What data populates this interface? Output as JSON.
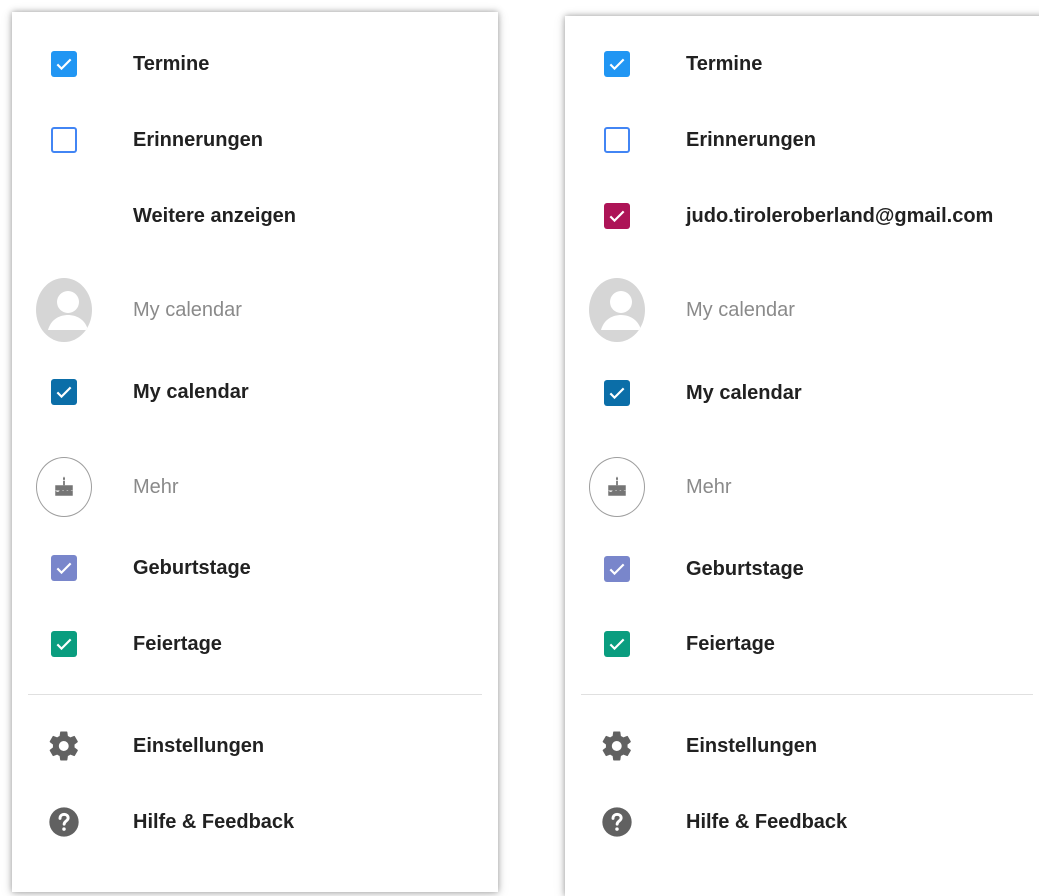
{
  "left": {
    "items": [
      {
        "label": "Termine"
      },
      {
        "label": "Erinnerungen"
      },
      {
        "label": "Weitere anzeigen"
      },
      {
        "label": "My calendar"
      },
      {
        "label": "My calendar"
      },
      {
        "label": "Mehr"
      },
      {
        "label": "Geburtstage"
      },
      {
        "label": "Feiertage"
      },
      {
        "label": "Einstellungen"
      },
      {
        "label": "Hilfe & Feedback"
      }
    ]
  },
  "right": {
    "items": [
      {
        "label": "Termine"
      },
      {
        "label": "Erinnerungen"
      },
      {
        "label": "judo.tiroleroberland@gmail.com"
      },
      {
        "label": "My calendar"
      },
      {
        "label": "My calendar"
      },
      {
        "label": "Mehr"
      },
      {
        "label": "Geburtstage"
      },
      {
        "label": "Feiertage"
      },
      {
        "label": "Einstellungen"
      },
      {
        "label": "Hilfe & Feedback"
      }
    ]
  },
  "colors": {
    "termine": "#2196f3",
    "erinnerungen_border": "#4285f4",
    "judo": "#ad1457",
    "my_calendar": "#0b6ea8",
    "geburtstage": "#7986cb",
    "feiertage": "#0a9d7f",
    "icon_gray": "#616161"
  },
  "icons": {
    "checkbox": "check-icon",
    "avatar": "person-icon",
    "birthday": "cake-icon",
    "settings": "gear-icon",
    "help": "help-icon"
  }
}
